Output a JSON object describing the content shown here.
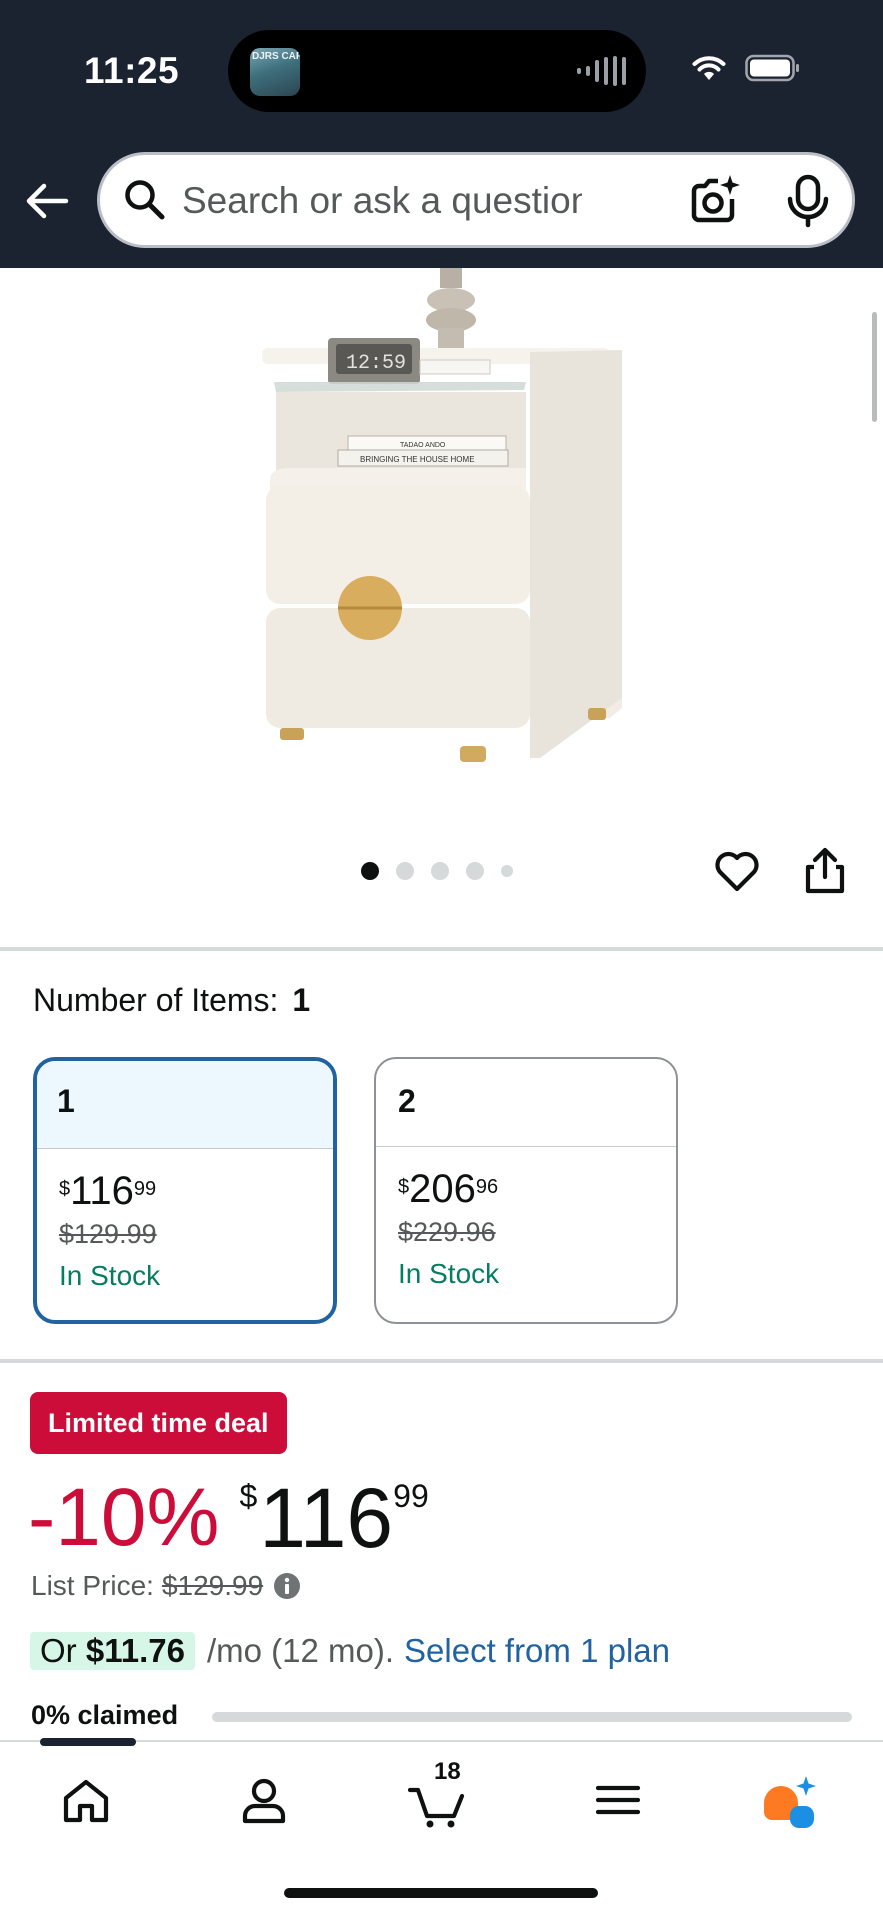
{
  "status_bar": {
    "time": "11:25",
    "island_art_text": "DJRS CAFE"
  },
  "header": {
    "search_placeholder": "Search or ask a question"
  },
  "gallery": {
    "image_count": 5,
    "active_index": 0,
    "product_image": "cream two-drawer nightstand with glass shelf and gold round handle"
  },
  "variation": {
    "label": "Number of Items:",
    "selected_value": "1",
    "options": [
      {
        "name": "1",
        "price_currency": "$",
        "price_whole": "116",
        "price_fraction": "99",
        "list_price": "$129.99",
        "availability": "In Stock",
        "selected": true
      },
      {
        "name": "2",
        "price_currency": "$",
        "price_whole": "206",
        "price_fraction": "96",
        "list_price": "$229.96",
        "availability": "In Stock",
        "selected": false
      }
    ]
  },
  "deal": {
    "badge": "Limited time deal",
    "discount": "-10%",
    "price_currency": "$",
    "price_whole": "116",
    "price_fraction": "99",
    "list_price_label": "List Price:",
    "list_price": "$129.99",
    "monthly_prefix": "Or",
    "monthly_amount": "$11.76",
    "monthly_suffix": "/mo (12 mo).",
    "plan_link": "Select from 1 plan",
    "claimed_label": "0% claimed",
    "claimed_fraction": 0
  },
  "bottom_nav": {
    "items": [
      "home",
      "account",
      "cart",
      "menu",
      "rufus"
    ],
    "cart_count": "18",
    "active": "home"
  },
  "colors": {
    "header_bg": "#1b2230",
    "deal_red": "#cc0c39",
    "link_blue": "#2162a1",
    "stock_green": "#067d62",
    "selected_border": "#2162a1",
    "rufus_orange": "#fe7a22",
    "rufus_blue": "#1a8fe3"
  }
}
